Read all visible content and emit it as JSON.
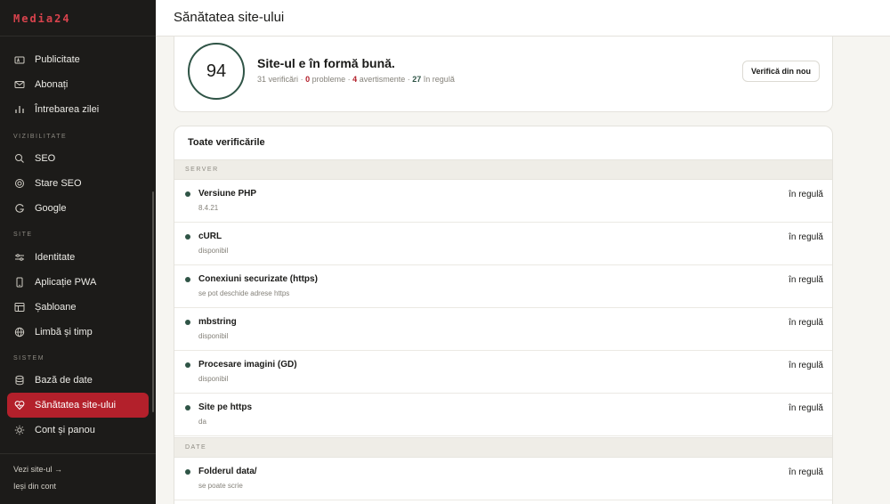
{
  "app": {
    "logo": "Media24"
  },
  "page": {
    "title": "Sănătatea site-ului"
  },
  "sidebar": {
    "items_top": [
      {
        "label": "Publicitate",
        "icon": "ad-icon"
      },
      {
        "label": "Abonați",
        "icon": "mail-icon"
      },
      {
        "label": "Întrebarea zilei",
        "icon": "bar-chart-icon"
      }
    ],
    "section_visibility": "VIZIBILITATE",
    "items_visibility": [
      {
        "label": "SEO",
        "icon": "search-icon"
      },
      {
        "label": "Stare SEO",
        "icon": "target-icon"
      },
      {
        "label": "Google",
        "icon": "google-icon"
      }
    ],
    "section_site": "SITE",
    "items_site": [
      {
        "label": "Identitate",
        "icon": "identity-icon"
      },
      {
        "label": "Aplicație PWA",
        "icon": "phone-icon"
      },
      {
        "label": "Șabloane",
        "icon": "layout-icon"
      },
      {
        "label": "Limbă și timp",
        "icon": "globe-icon"
      }
    ],
    "section_system": "SISTEM",
    "items_system": [
      {
        "label": "Bază de date",
        "icon": "database-icon"
      },
      {
        "label": "Sănătatea site-ului",
        "icon": "heart-pulse-icon",
        "active": true
      },
      {
        "label": "Cont și panou",
        "icon": "sun-icon"
      }
    ],
    "footer": {
      "view_site": "Vezi site-ul →",
      "logout": "Ieși din cont"
    }
  },
  "score": {
    "value": "94",
    "title": "Site-ul e în formă bună.",
    "checks_count": "31",
    "checks_label": "verificări",
    "problems_count": "0",
    "problems_label": "probleme",
    "warnings_count": "4",
    "warnings_label": "avertismente",
    "ok_count": "27",
    "ok_label": "în regulă",
    "sep": "·",
    "recheck_label": "Verifică din nou"
  },
  "checks": {
    "title": "Toate verificările",
    "groups": [
      {
        "name": "SERVER",
        "rows": [
          {
            "name": "Versiune PHP",
            "detail": "8.4.21",
            "status": "în regulă"
          },
          {
            "name": "cURL",
            "detail": "disponibil",
            "status": "în regulă"
          },
          {
            "name": "Conexiuni securizate (https)",
            "detail": "se pot deschide adrese https",
            "status": "în regulă"
          },
          {
            "name": "mbstring",
            "detail": "disponibil",
            "status": "în regulă"
          },
          {
            "name": "Procesare imagini (GD)",
            "detail": "disponibil",
            "status": "în regulă"
          },
          {
            "name": "Site pe https",
            "detail": "da",
            "status": "în regulă"
          }
        ]
      },
      {
        "name": "DATE",
        "rows": [
          {
            "name": "Folderul data/",
            "detail": "se poate scrie",
            "status": "în regulă"
          }
        ]
      }
    ]
  },
  "colors": {
    "accent": "#b3202b",
    "ok": "#2f5446",
    "sidebar_bg": "#1c1b19"
  }
}
